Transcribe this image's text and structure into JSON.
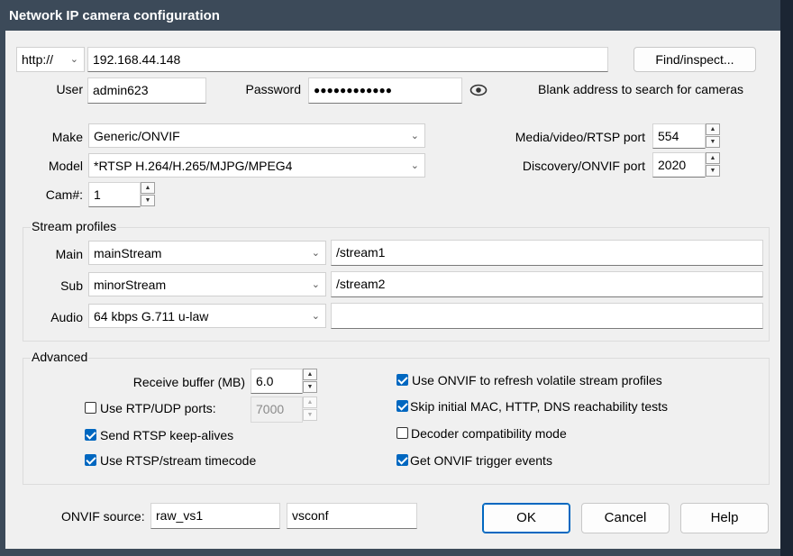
{
  "window": {
    "title": "Network IP camera configuration"
  },
  "address": {
    "protocol": "http://",
    "host": "192.168.44.148",
    "find_button": "Find/inspect...",
    "user_label": "User",
    "user_value": "admin623",
    "password_label": "Password",
    "password_value": "●●●●●●●●●●●●",
    "hint": "Blank address to search for cameras"
  },
  "device": {
    "make_label": "Make",
    "make_value": "Generic/ONVIF",
    "model_label": "Model",
    "model_value": "*RTSP H.264/H.265/MJPG/MPEG4",
    "cam_label": "Cam#:",
    "cam_value": "1",
    "media_port_label": "Media/video/RTSP port",
    "media_port_value": "554",
    "discovery_port_label": "Discovery/ONVIF port",
    "discovery_port_value": "2020"
  },
  "streams": {
    "caption": "Stream profiles",
    "main_label": "Main",
    "main_profile": "mainStream",
    "main_path": "/stream1",
    "sub_label": "Sub",
    "sub_profile": "minorStream",
    "sub_path": "/stream2",
    "audio_label": "Audio",
    "audio_profile": "64 kbps G.711 u-law",
    "audio_path": ""
  },
  "advanced": {
    "caption": "Advanced",
    "receive_buffer_label": "Receive buffer (MB)",
    "receive_buffer_value": "6.0",
    "rtp_udp_label": "Use RTP/UDP ports:",
    "rtp_udp_checked": false,
    "rtp_udp_value": "7000",
    "keepalive_label": "Send RTSP keep-alives",
    "keepalive_checked": true,
    "timecode_label": "Use RTSP/stream timecode",
    "timecode_checked": true,
    "onvif_refresh_label": "Use ONVIF to refresh volatile stream profiles",
    "onvif_refresh_checked": true,
    "skip_tests_label": "Skip initial MAC, HTTP, DNS reachability tests",
    "skip_tests_checked": true,
    "decoder_compat_label": "Decoder compatibility mode",
    "decoder_compat_checked": false,
    "trigger_events_label": "Get ONVIF trigger events",
    "trigger_events_checked": true
  },
  "footer": {
    "onvif_source_label": "ONVIF source:",
    "onvif_source_value": "raw_vs1",
    "onvif_source_conf": "vsconf",
    "ok": "OK",
    "cancel": "Cancel",
    "help": "Help"
  },
  "colors": {
    "title_bar": "#3c4a59",
    "accent": "#0067c0",
    "dialog_bg": "#f0f0f0"
  }
}
